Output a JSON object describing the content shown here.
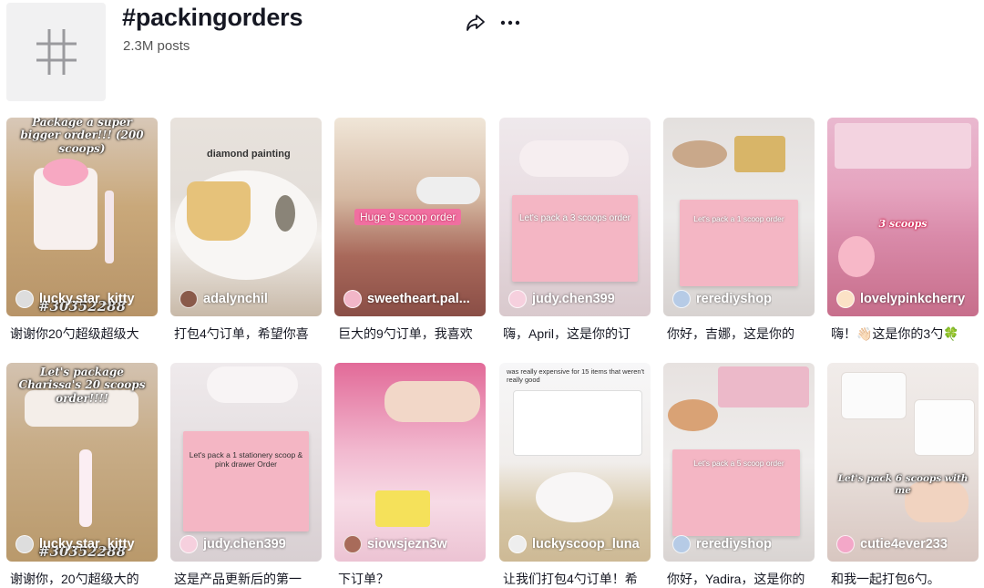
{
  "header": {
    "title": "#packingorders",
    "post_count": "2.3M posts"
  },
  "videos": [
    {
      "author": "lucky.star_kitty",
      "caption": "谢谢你20勺超级超级大",
      "overlay": "Package a super bigger order!!! (200 scoops)",
      "sub_overlay": "#30352288"
    },
    {
      "author": "adalynchil",
      "caption": "打包4勺订单，希望你喜",
      "overlay": "diamond painting"
    },
    {
      "author": "sweetheart.pal...",
      "caption": "巨大的9勺订单，我喜欢",
      "overlay": "Huge 9 scoop order"
    },
    {
      "author": "judy.chen399",
      "caption": "嗨，April，这是你的订",
      "overlay": "Let's pack a 3 scoops order"
    },
    {
      "author": "rerediyshop",
      "caption": "你好，吉娜，这是你的",
      "overlay": "Let's pack a 1 scoop order"
    },
    {
      "author": "lovelypinkcherry",
      "caption": "嗨！👋🏻这是你的3勺🍀",
      "overlay": "3 scoops"
    },
    {
      "author": "lucky.star_kitty",
      "caption": "谢谢你，20勺超级大的",
      "overlay": "Let's package Charissa's 20 scoops order!!!!",
      "sub_overlay": "#30352288"
    },
    {
      "author": "judy.chen399",
      "caption": "这是产品更新后的第一",
      "overlay": "Let's pack a 1 stationery scoop & pink drawer Order"
    },
    {
      "author": "siowsjezn3w",
      "caption": "下订单？",
      "overlay": ""
    },
    {
      "author": "luckyscoop_luna",
      "caption": "让我们打包4勺订单！希",
      "overlay": "was really expensive for 15 items that weren't really good"
    },
    {
      "author": "rerediyshop",
      "caption": "你好，Yadira，这是你的",
      "overlay": "Let's pack a 5 scoop order"
    },
    {
      "author": "cutie4ever233",
      "caption": "和我一起打包6勺。",
      "overlay": "Let's pack 6 scoops with me"
    }
  ]
}
